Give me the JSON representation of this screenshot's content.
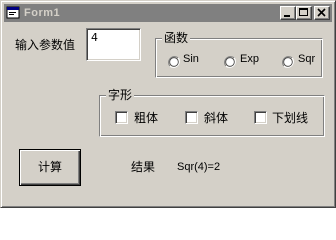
{
  "window": {
    "title": "Form1",
    "controls": [
      "minimize",
      "maximize",
      "close"
    ]
  },
  "input": {
    "label": "输入参数值",
    "value": "4"
  },
  "function_group": {
    "caption": "函数",
    "options": [
      {
        "label": "Sin",
        "selected": false
      },
      {
        "label": "Exp",
        "selected": false
      },
      {
        "label": "Sqr",
        "selected": false
      }
    ]
  },
  "font_group": {
    "caption": "字形",
    "options": [
      {
        "label": "粗体",
        "checked": false
      },
      {
        "label": "斜体",
        "checked": false
      },
      {
        "label": "下划线",
        "checked": false
      }
    ]
  },
  "compute_button": {
    "label": "计算"
  },
  "result": {
    "label": "结果",
    "value": "Sqr(4)=2"
  },
  "colors": {
    "face": "#d4d0c8",
    "inactive_title": "#808080",
    "window_bg": "#ffffff"
  }
}
